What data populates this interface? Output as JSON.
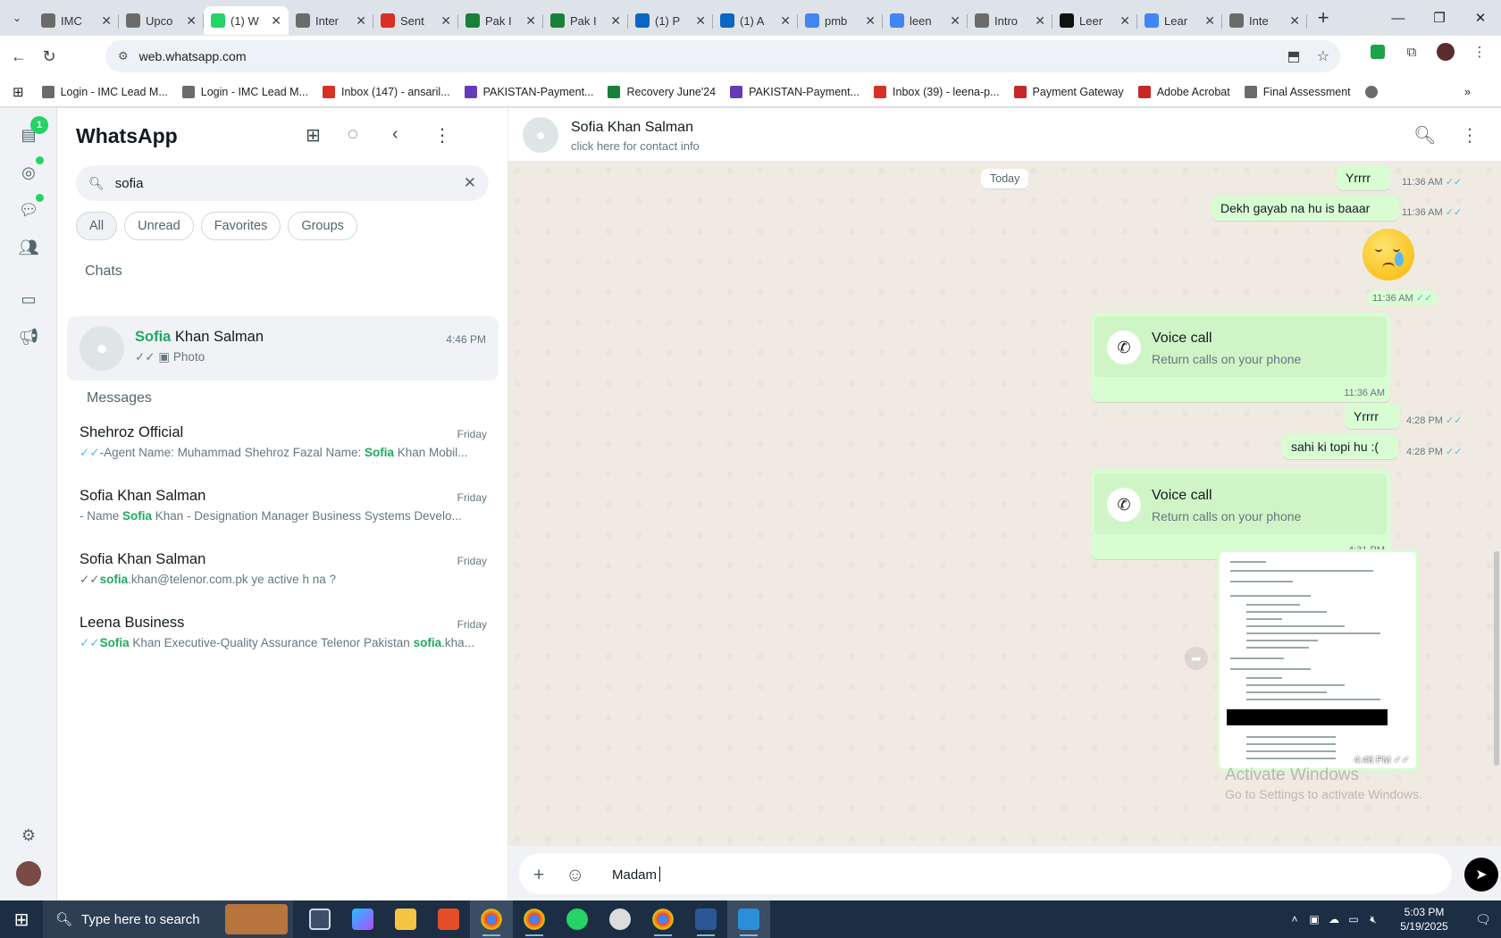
{
  "browser": {
    "tabs": [
      {
        "label": "IMC",
        "color": "#6b6b6b",
        "active": false
      },
      {
        "label": "Upco",
        "color": "#6b6b6b",
        "active": false
      },
      {
        "label": "(1) W",
        "color": "#25d366",
        "active": true
      },
      {
        "label": "Inter",
        "color": "#6b6b6b",
        "active": false
      },
      {
        "label": "Sent",
        "color": "#d93025",
        "active": false
      },
      {
        "label": "Pak I",
        "color": "#188038",
        "active": false
      },
      {
        "label": "Pak I",
        "color": "#188038",
        "active": false
      },
      {
        "label": "(1) P",
        "color": "#0a66c2",
        "active": false
      },
      {
        "label": "(1) A",
        "color": "#0a66c2",
        "active": false
      },
      {
        "label": "pmb",
        "color": "#4285f4",
        "active": false
      },
      {
        "label": "leen",
        "color": "#4285f4",
        "active": false
      },
      {
        "label": "Intro",
        "color": "#6b6b6b",
        "active": false
      },
      {
        "label": "Leer",
        "color": "#111111",
        "active": false
      },
      {
        "label": "Lear",
        "color": "#4285f4",
        "active": false
      },
      {
        "label": "Inte",
        "color": "#6b6b6b",
        "active": false
      }
    ],
    "url": "web.whatsapp.com",
    "bookmarks": [
      {
        "label": "Login - IMC Lead M...",
        "color": "#6b6b6b"
      },
      {
        "label": "Login - IMC Lead M...",
        "color": "#6b6b6b"
      },
      {
        "label": "Inbox (147) - ansaril...",
        "color": "#d93025"
      },
      {
        "label": "PAKISTAN-Payment...",
        "color": "#673ab7"
      },
      {
        "label": "Recovery June'24",
        "color": "#188038"
      },
      {
        "label": "PAKISTAN-Payment...",
        "color": "#673ab7"
      },
      {
        "label": "Inbox (39) - leena-p...",
        "color": "#d93025"
      },
      {
        "label": "Payment Gateway",
        "color": "#c62828"
      },
      {
        "label": "Adobe Acrobat",
        "color": "#c62828"
      },
      {
        "label": "Final Assessment",
        "color": "#6b6b6b"
      }
    ]
  },
  "whatsapp": {
    "app_title": "WhatsApp",
    "rail_badge": "1",
    "search_value": "sofia",
    "filters": [
      "All",
      "Unread",
      "Favorites",
      "Groups"
    ],
    "chats_heading": "Chats",
    "messages_heading": "Messages",
    "top_chat": {
      "name_highlight": "Sofia",
      "name_rest": " Khan Salman",
      "time": "4:46 PM",
      "preview": "Photo"
    },
    "message_results": [
      {
        "name": "Shehroz Official",
        "time": "Friday",
        "pre": "-Agent Name: Muhammad Shehroz Fazal Name: ",
        "hl": "Sofia",
        "post": " Khan Mobil...",
        "tick": "blue"
      },
      {
        "name": "Sofia Khan Salman",
        "time": "Friday",
        "pre": "- Name ",
        "hl": "Sofia",
        "post": " Khan - Designation   Manager Business Systems Develo...",
        "tick": "none"
      },
      {
        "name": "Sofia Khan Salman",
        "time": "Friday",
        "pre": "",
        "hl": "sofia",
        "post": ".khan@telenor.com.pk ye active h na ?",
        "tick": "grey"
      },
      {
        "name": "Leena Business",
        "time": "Friday",
        "pre": "",
        "hl": "Sofia",
        "post": " Khan Executive-Quality Assurance Telenor Pakistan ",
        "hl2": "sofia",
        "post2": ".kha...",
        "tick": "blue"
      }
    ],
    "conversation": {
      "contact_name": "Sofia Khan Salman",
      "contact_sub": "click here for contact info",
      "day_label": "Today",
      "msg1": {
        "text": "Yrrrr",
        "time": "11:36 AM"
      },
      "msg2": {
        "text": "Dekh gayab na hu is baaar",
        "time": "11:36 AM"
      },
      "emoji_time": "11:36 AM",
      "call1": {
        "title": "Voice call",
        "sub": "Return calls on your phone",
        "time": "11:36 AM"
      },
      "msg3": {
        "text": "Yrrrr",
        "time": "4:28 PM"
      },
      "msg4": {
        "text": "sahi ki topi hu :(",
        "time": "4:28 PM"
      },
      "call2": {
        "title": "Voice call",
        "sub": "Return calls on your phone",
        "time": "4:31 PM"
      },
      "photo_time": "4:46 PM",
      "composer_text": "Madam"
    },
    "watermark_title": "Activate Windows",
    "watermark_sub": "Go to Settings to activate Windows."
  },
  "taskbar": {
    "search_placeholder": "Type here to search",
    "time": "5:03 PM",
    "date": "5/19/2025"
  }
}
